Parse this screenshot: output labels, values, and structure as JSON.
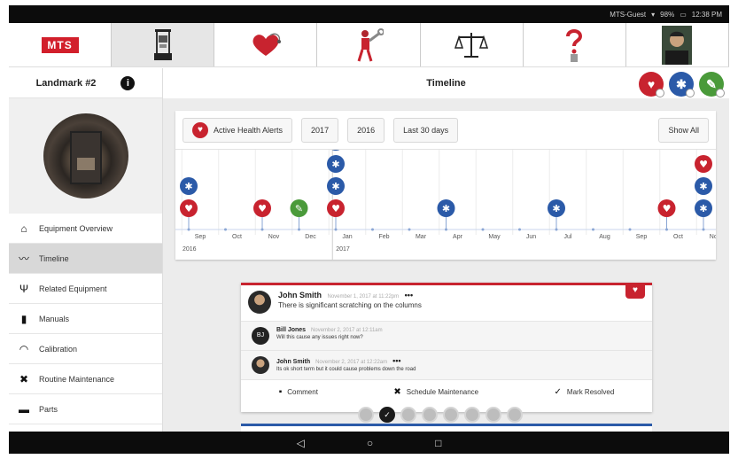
{
  "status_bar": {
    "network": "MTS-Guest",
    "battery": "98%",
    "time": "12:38 PM"
  },
  "top_nav": {
    "tabs": [
      {
        "name": "mts-logo",
        "label": "MTS"
      },
      {
        "name": "equipment",
        "icon": "machine-icon"
      },
      {
        "name": "health",
        "icon": "heart-stethoscope-icon"
      },
      {
        "name": "maintenance",
        "icon": "worker-wrench-icon"
      },
      {
        "name": "compliance",
        "icon": "scales-icon"
      },
      {
        "name": "help",
        "icon": "question-person-icon"
      },
      {
        "name": "profile",
        "icon": "user-avatar-icon"
      }
    ]
  },
  "sidebar": {
    "title": "Landmark #2",
    "info_icon": "i",
    "items": [
      {
        "label": "Equipment Overview",
        "icon": "home-icon",
        "glyph": "⌂"
      },
      {
        "label": "Timeline",
        "icon": "timeline-icon",
        "glyph": "〰",
        "active": true
      },
      {
        "label": "Related Equipment",
        "icon": "related-icon",
        "glyph": "Ψ"
      },
      {
        "label": "Manuals",
        "icon": "manual-icon",
        "glyph": "▮"
      },
      {
        "label": "Calibration",
        "icon": "gauge-icon",
        "glyph": "◠"
      },
      {
        "label": "Routine Maintenance",
        "icon": "tools-icon",
        "glyph": "✖"
      },
      {
        "label": "Parts",
        "icon": "cart-icon",
        "glyph": "▬"
      }
    ]
  },
  "main": {
    "title": "Timeline",
    "header_buttons": [
      {
        "icon": "health-alert-icon",
        "glyph": "♥",
        "color": "#c8232f"
      },
      {
        "icon": "maintenance-icon",
        "glyph": "🔧",
        "color": "#2b5aa8"
      },
      {
        "icon": "edit-icon",
        "glyph": "✎",
        "color": "#4a9a3a"
      }
    ]
  },
  "timeline": {
    "filters": [
      "Active Health Alerts",
      "2017",
      "2016",
      "Last 30 days"
    ],
    "show_all": "Show All",
    "months": [
      "Sep",
      "Oct",
      "Nov",
      "Dec",
      "Jan",
      "Feb",
      "Mar",
      "Apr",
      "May",
      "Jun",
      "Jul",
      "Aug",
      "Sep",
      "Oct",
      "Nov"
    ],
    "years": [
      "2016",
      "2017"
    ],
    "events": [
      {
        "month_index": 0,
        "stack": [
          "health",
          "maintenance"
        ]
      },
      {
        "month_index": 2,
        "stack": [
          "health"
        ]
      },
      {
        "month_index": 3,
        "stack": [
          "note"
        ]
      },
      {
        "month_index": 4,
        "stack": [
          "health",
          "maintenance",
          "maintenance",
          "maintenance"
        ]
      },
      {
        "month_index": 7,
        "stack": [
          "maintenance"
        ]
      },
      {
        "month_index": 10,
        "stack": [
          "maintenance"
        ]
      },
      {
        "month_index": 13,
        "stack": [
          "health"
        ]
      },
      {
        "month_index": 14,
        "stack": [
          "maintenance",
          "maintenance",
          "health"
        ]
      }
    ],
    "colors": {
      "health": "#c8232f",
      "maintenance": "#2b5aa8",
      "note": "#4a9a3a",
      "month_line": "#8aa6d4",
      "current": "#e06b6b"
    }
  },
  "comment": {
    "author": "John Smith",
    "time": "November 1, 2017 at 11:22pm",
    "dots": "•••",
    "text": "There is significant scratching on the columns",
    "replies": [
      {
        "author": "Bill Jones",
        "initials": "BJ",
        "time": "November 2, 2017 at 12:11am",
        "text": "Will this cause any issues right now?",
        "dots": ""
      },
      {
        "author": "John Smith",
        "initials": "",
        "time": "November 2, 2017 at 12:22am",
        "text": "Its ok short term but it could cause problems down the road",
        "dots": "•••"
      }
    ],
    "actions": [
      {
        "label": "Comment",
        "icon": "comment-icon",
        "glyph": "▪"
      },
      {
        "label": "Schedule Maintenance",
        "icon": "tools-icon",
        "glyph": "✖"
      },
      {
        "label": "Mark Resolved",
        "icon": "check-icon",
        "glyph": "✓"
      }
    ]
  },
  "pager": {
    "count": 8,
    "active": 1
  },
  "nav_bar": {
    "back": "◁",
    "home": "○",
    "recents": "□"
  }
}
